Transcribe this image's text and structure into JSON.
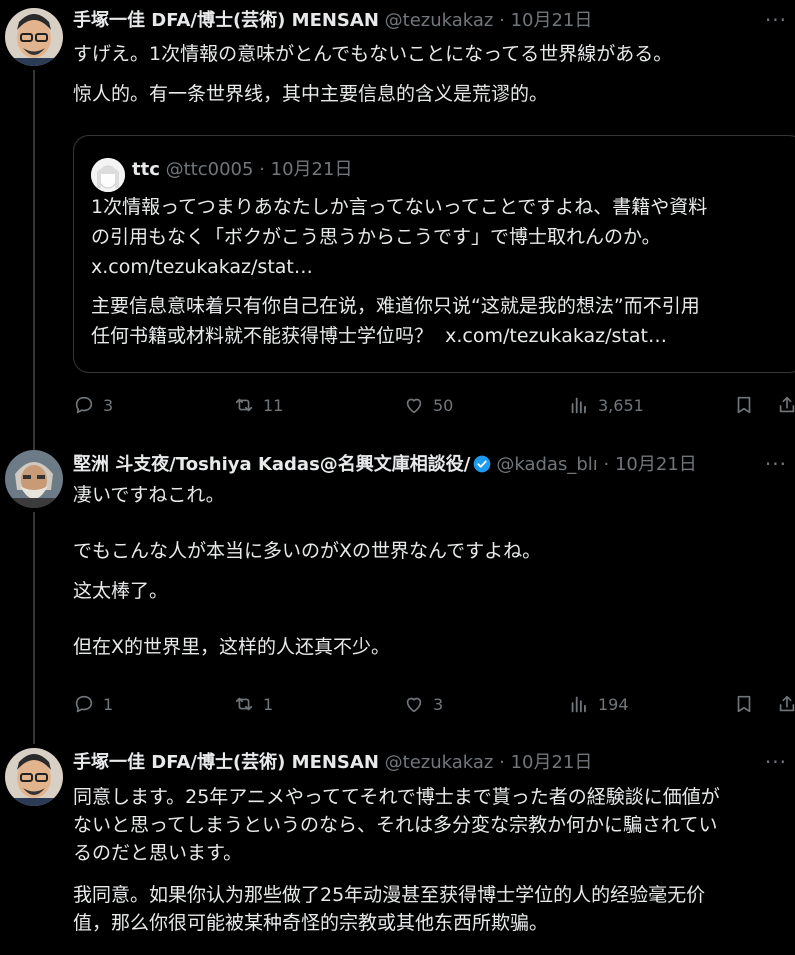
{
  "tweets": [
    {
      "name": "手塚一佳 DFA/博士(芸術) MENSAN",
      "handle": "@tezukakaz",
      "date": "10月21日",
      "text_ja": "すげえ。1次情報の意味がとんでもないことになってる世界線がある。",
      "text_zh": "惊人的。有一条世界线，其中主要信息的含义是荒谬的。",
      "quote": {
        "name": "ttc",
        "handle": "@ttc0005",
        "date": "10月21日",
        "text_ja_1": "1次情報ってつまりあなたしか言ってないってことですよね、書籍や資料",
        "text_ja_2": "の引用もなく「ボクがこう思うからこうです」で博士取れんのか。",
        "link_1": "x.com/tezukakaz/stat…",
        "text_zh_1": "主要信息意味着只有你自己在说，难道你只说“这就是我的想法”而不引用",
        "text_zh_2": "任何书籍或材料就不能获得博士学位吗？",
        "link_2": "x.com/tezukakaz/stat…"
      },
      "actions": {
        "replies": "3",
        "reposts": "11",
        "likes": "50",
        "views": "3,651"
      }
    },
    {
      "name": "堅洲 斗支夜/Toshiya Kadas@名興文庫相談役/",
      "handle": "@kadas_blı",
      "date": "10月21日",
      "text_1": "凄いですねこれ。",
      "text_2": "でもこんな人が本当に多いのがXの世界なんですよね。",
      "text_3": "这太棒了。",
      "text_4": "但在X的世界里，这样的人还真不少。",
      "actions": {
        "replies": "1",
        "reposts": "1",
        "likes": "3",
        "views": "194"
      }
    },
    {
      "name": "手塚一佳 DFA/博士(芸術) MENSAN",
      "handle": "@tezukakaz",
      "date": "10月21日",
      "text_1": "同意します。25年アニメやっててそれで博士まで貰った者の経験談に価値が",
      "text_2": "ないと思ってしまうというのなら、それは多分変な宗教か何かに騙されてい",
      "text_3": "るのだと思います。",
      "text_4": "我同意。如果你认为那些做了25年动漫甚至获得博士学位的人的经验毫无价",
      "text_5": "值，那么你很可能被某种奇怪的宗教或其他东西所欺骗。"
    }
  ],
  "colors": {
    "background": "#000000",
    "text": "#e7e9ea",
    "muted": "#71767b",
    "border": "#333639",
    "verified": "#1d9bf0"
  }
}
